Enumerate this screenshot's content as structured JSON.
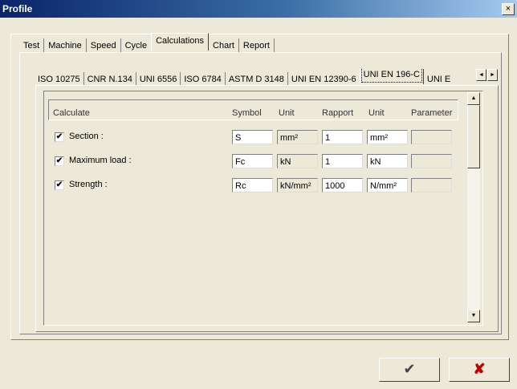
{
  "window": {
    "title": "Profile",
    "close_icon": "×"
  },
  "main_tabs": [
    {
      "label": "Test"
    },
    {
      "label": "Machine"
    },
    {
      "label": "Speed"
    },
    {
      "label": "Cycle"
    },
    {
      "label": "Calculations",
      "active": true
    },
    {
      "label": "Chart"
    },
    {
      "label": "Report"
    }
  ],
  "standard_tabs": [
    {
      "label": "ISO 10275"
    },
    {
      "label": "CNR N.134"
    },
    {
      "label": "UNI 6556"
    },
    {
      "label": "ISO 6784"
    },
    {
      "label": "ASTM D 3148"
    },
    {
      "label": "UNI EN 12390-6"
    },
    {
      "label": "UNI EN 196-C",
      "active": true
    },
    {
      "label": "UNI E"
    }
  ],
  "tab_scroll": {
    "left_icon": "◄",
    "right_icon": "►"
  },
  "grid": {
    "headers": {
      "calculate": "Calculate",
      "symbol": "Symbol",
      "unit": "Unit",
      "rapport": "Rapport",
      "unit2": "Unit",
      "parameter": "Parameter"
    },
    "rows": [
      {
        "checked": "✔",
        "label": "Section :",
        "symbol": "S",
        "unit": "mm²",
        "rapport": "1",
        "unit2": "mm²",
        "parameter": ""
      },
      {
        "checked": "✔",
        "label": "Maximum load :",
        "symbol": "Fc",
        "unit": "kN",
        "rapport": "1",
        "unit2": "kN",
        "parameter": ""
      },
      {
        "checked": "✔",
        "label": "Strength :",
        "symbol": "Rc",
        "unit": "kN/mm²",
        "rapport": "1000",
        "unit2": "N/mm²",
        "parameter": ""
      }
    ]
  },
  "scrollbar": {
    "up_icon": "▲",
    "down_icon": "▼"
  },
  "buttons": {
    "ok": "✔",
    "cancel": "✘"
  }
}
